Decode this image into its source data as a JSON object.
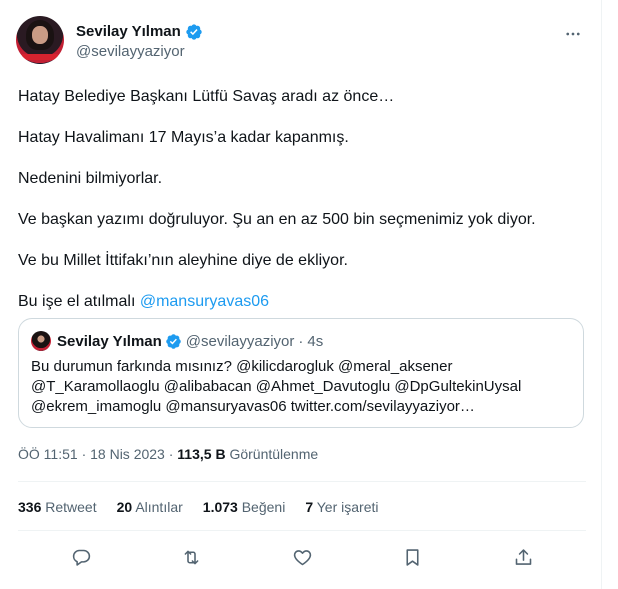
{
  "author": {
    "display_name": "Sevilay Yılman",
    "handle": "@sevilayyaziyor"
  },
  "tweet": {
    "lines": [
      "Hatay Belediye Başkanı Lütfü Savaş aradı az önce…",
      "Hatay Havalimanı 17 Mayıs’a kadar kapanmış.",
      "Nedenini bilmiyorlar.",
      "Ve başkan yazımı doğruluyor. Şu an en az 500 bin seçmenimiz yok diyor.",
      "Ve bu Millet İttifakı’nın aleyhine diye de ekliyor."
    ],
    "last_line_prefix": "Bu işe el atılmalı ",
    "last_line_mention": "@mansuryavas06"
  },
  "quote": {
    "display_name": "Sevilay Yılman",
    "handle": "@sevilayyaziyor",
    "separator": "·",
    "age": "4s",
    "text_lines": [
      "Bu durumun farkında mısınız?  @kilicdarogluk @meral_aksener",
      "@T_Karamollaoglu @alibabacan @Ahmet_Davutoglu @DpGultekinUysal",
      "@ekrem_imamoglu @mansuryavas06 twitter.com/sevilayyaziyor…"
    ]
  },
  "meta": {
    "time": "ÖÖ 11:51",
    "sep1": "·",
    "date": "18 Nis 2023",
    "sep2": "·",
    "views_count": "113,5 B",
    "views_label": "Görüntülenme"
  },
  "stats": {
    "retweets_count": "336",
    "retweets_label": "Retweet",
    "quotes_count": "20",
    "quotes_label": "Alıntılar",
    "likes_count": "1.073",
    "likes_label": "Beğeni",
    "bookmarks_count": "7",
    "bookmarks_label": "Yer işareti"
  },
  "icons": {
    "verified": "verified-badge-icon",
    "more": "more-horizontal-icon",
    "reply": "reply-icon",
    "retweet": "retweet-icon",
    "like": "heart-icon",
    "bookmark": "bookmark-icon",
    "share": "share-icon"
  },
  "colors": {
    "accent": "#1d9bf0",
    "secondary_text": "#536471",
    "border": "#cfd9de"
  }
}
